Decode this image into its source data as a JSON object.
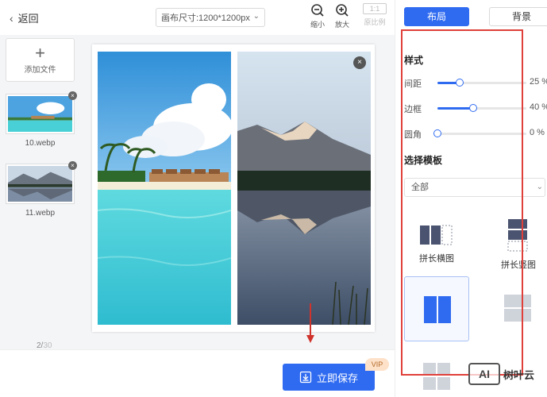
{
  "header": {
    "back_label": "返回",
    "canvas_size": "画布尺寸:1200*1200px",
    "zoom_out_label": "缩小",
    "zoom_in_label": "放大",
    "ratio_box": "1:1",
    "ratio_label": "原比例"
  },
  "files": {
    "add_label": "添加文件",
    "items": [
      {
        "name": "10.webp"
      },
      {
        "name": "11.webp"
      }
    ]
  },
  "pager": {
    "current": "2/",
    "total": "30"
  },
  "footer": {
    "save_label": "立即保存",
    "vip_badge": "VIP"
  },
  "right": {
    "tabs": [
      {
        "label": "布局",
        "active": true
      },
      {
        "label": "背景",
        "active": false
      }
    ],
    "style_title": "样式",
    "sliders": [
      {
        "label": "间距",
        "value": 25,
        "display": "25 %"
      },
      {
        "label": "边框",
        "value": 40,
        "display": "40 %"
      },
      {
        "label": "圆角",
        "value": 0,
        "display": "0 %"
      }
    ],
    "template_title": "选择模板",
    "template_filter": "全部",
    "templates": [
      {
        "label": "拼长横图"
      },
      {
        "label": "拼长竖图"
      }
    ]
  },
  "watermark": {
    "logo": "AI",
    "text": "树叶云"
  },
  "colors": {
    "accent": "#2f6bf1",
    "highlight": "#e0403a",
    "vip_bg": "#fde1c8"
  }
}
